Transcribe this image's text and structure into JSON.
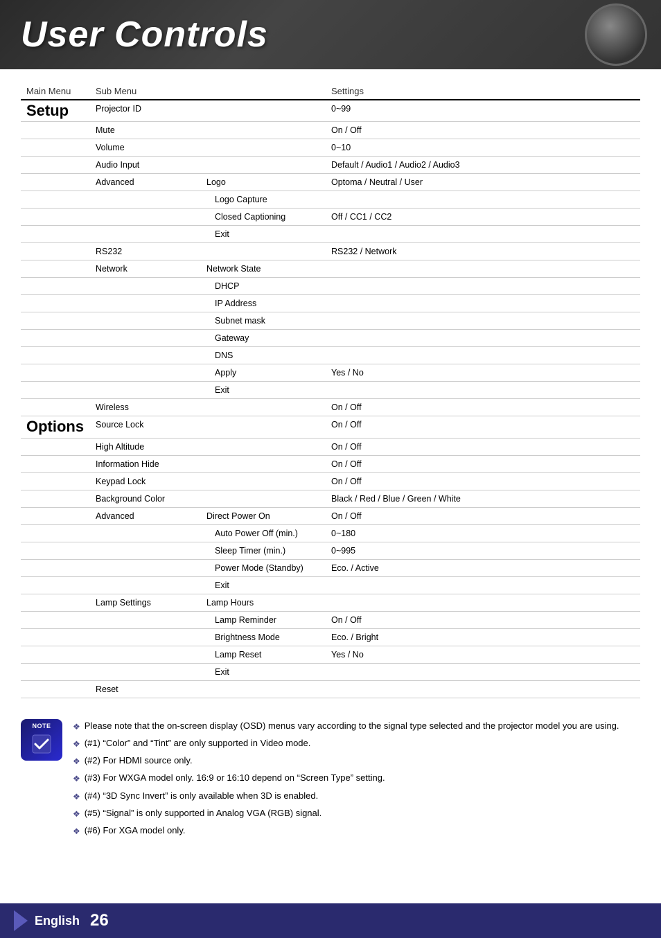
{
  "header": {
    "title": "User Controls"
  },
  "footer": {
    "language": "English",
    "page_number": "26"
  },
  "table": {
    "headers": {
      "main_menu": "Main Menu",
      "sub_menu": "Sub Menu",
      "settings": "Settings"
    },
    "sections": [
      {
        "id": "setup",
        "label": "Setup",
        "rows": [
          {
            "sub": "Projector ID",
            "sub2": "",
            "settings": "0~99"
          },
          {
            "sub": "Mute",
            "sub2": "",
            "settings": "On / Off"
          },
          {
            "sub": "Volume",
            "sub2": "",
            "settings": "0~10"
          },
          {
            "sub": "Audio Input",
            "sub2": "",
            "settings": "Default / Audio1 / Audio2 / Audio3"
          },
          {
            "sub": "Advanced",
            "sub2": "Logo",
            "settings": "Optoma / Neutral / User"
          },
          {
            "sub": "",
            "sub2": "Logo Capture",
            "settings": ""
          },
          {
            "sub": "",
            "sub2": "Closed Captioning",
            "settings": "Off / CC1 / CC2"
          },
          {
            "sub": "",
            "sub2": "Exit",
            "settings": ""
          },
          {
            "sub": "RS232",
            "sub2": "",
            "settings": "RS232 / Network"
          },
          {
            "sub": "Network",
            "sub2": "Network State",
            "settings": ""
          },
          {
            "sub": "",
            "sub2": "DHCP",
            "settings": ""
          },
          {
            "sub": "",
            "sub2": "IP Address",
            "settings": ""
          },
          {
            "sub": "",
            "sub2": "Subnet mask",
            "settings": ""
          },
          {
            "sub": "",
            "sub2": "Gateway",
            "settings": ""
          },
          {
            "sub": "",
            "sub2": "DNS",
            "settings": ""
          },
          {
            "sub": "",
            "sub2": "Apply",
            "settings": "Yes / No"
          },
          {
            "sub": "",
            "sub2": "Exit",
            "settings": ""
          },
          {
            "sub": "Wireless",
            "sub2": "",
            "settings": "On / Off"
          }
        ]
      },
      {
        "id": "options",
        "label": "Options",
        "rows": [
          {
            "sub": "Source Lock",
            "sub2": "",
            "settings": "On / Off"
          },
          {
            "sub": "High Altitude",
            "sub2": "",
            "settings": "On / Off"
          },
          {
            "sub": "Information Hide",
            "sub2": "",
            "settings": "On / Off"
          },
          {
            "sub": "Keypad Lock",
            "sub2": "",
            "settings": "On / Off"
          },
          {
            "sub": "Background Color",
            "sub2": "",
            "settings": "Black / Red / Blue / Green / White"
          },
          {
            "sub": "Advanced",
            "sub2": "Direct Power On",
            "settings": "On / Off"
          },
          {
            "sub": "",
            "sub2": "Auto Power Off (min.)",
            "settings": "0~180"
          },
          {
            "sub": "",
            "sub2": "Sleep Timer (min.)",
            "settings": "0~995"
          },
          {
            "sub": "",
            "sub2": "Power Mode (Standby)",
            "settings": "Eco. / Active"
          },
          {
            "sub": "",
            "sub2": "Exit",
            "settings": ""
          },
          {
            "sub": "Lamp Settings",
            "sub2": "Lamp Hours",
            "settings": ""
          },
          {
            "sub": "",
            "sub2": "Lamp Reminder",
            "settings": "On / Off"
          },
          {
            "sub": "",
            "sub2": "Brightness Mode",
            "settings": "Eco. / Bright"
          },
          {
            "sub": "",
            "sub2": "Lamp Reset",
            "settings": "Yes / No"
          },
          {
            "sub": "",
            "sub2": "Exit",
            "settings": ""
          },
          {
            "sub": "Reset",
            "sub2": "",
            "settings": ""
          }
        ]
      }
    ]
  },
  "notes": {
    "main_text": "Please note that the on-screen display (OSD) menus vary according to the signal type selected and the projector model you are using.",
    "items": [
      "(#1) “Color” and “Tint” are only supported in Video mode.",
      "(#2) For HDMI source only.",
      "(#3) For WXGA model only. 16:9 or 16:10 depend on “Screen Type” setting.",
      "(#4) “3D Sync Invert” is only available when 3D is enabled.",
      "(#5) “Signal” is only supported in Analog VGA (RGB) signal.",
      "(#6) For XGA model only."
    ]
  }
}
